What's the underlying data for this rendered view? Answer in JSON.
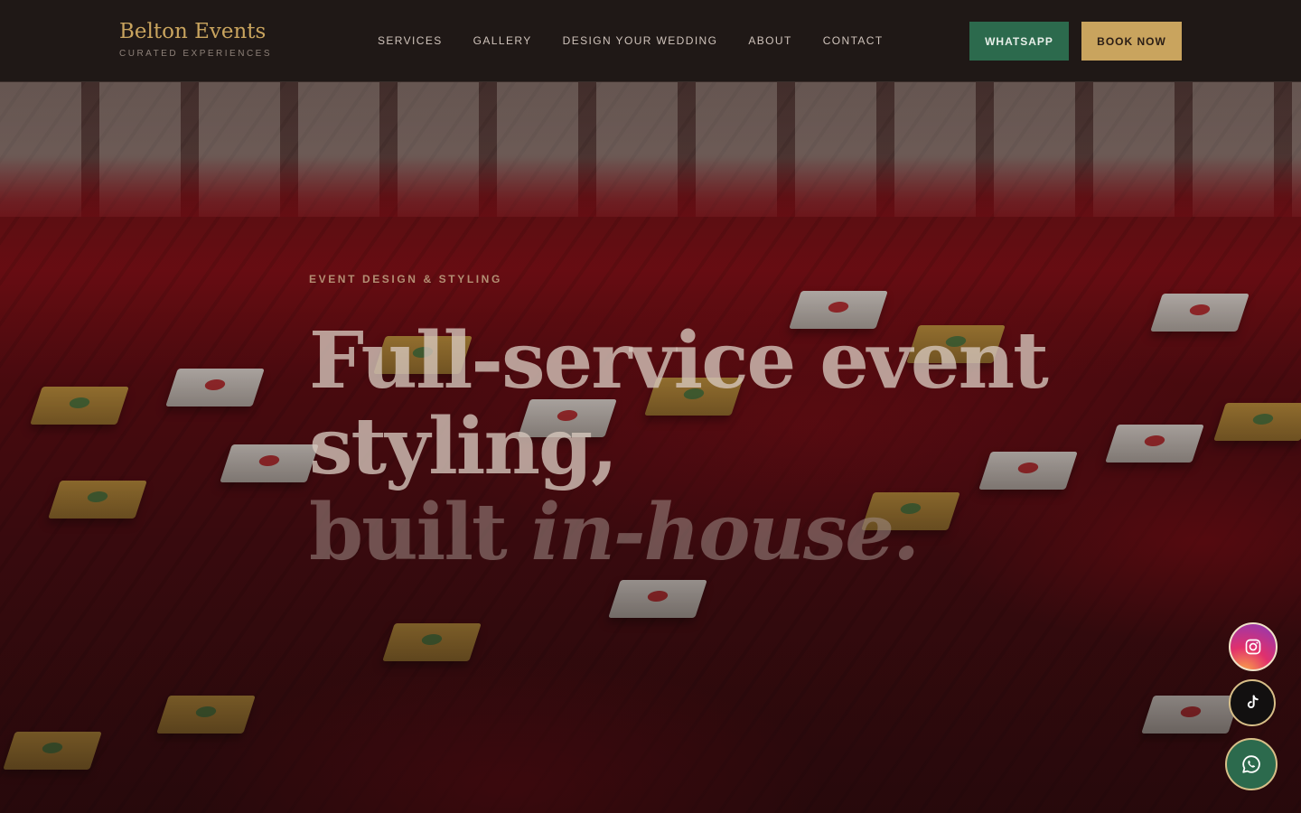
{
  "brand": {
    "name": "Belton Events",
    "tagline": "CURATED EXPERIENCES"
  },
  "nav": {
    "items": [
      {
        "label": "SERVICES"
      },
      {
        "label": "GALLERY"
      },
      {
        "label": "DESIGN YOUR WEDDING"
      },
      {
        "label": "ABOUT"
      },
      {
        "label": "CONTACT"
      }
    ]
  },
  "header_actions": {
    "whatsapp_label": "WHATSAPP",
    "book_label": "BOOK NOW"
  },
  "hero": {
    "eyebrow": "EVENT DESIGN & STYLING",
    "headline_line1": "Full-service event",
    "headline_line2": "styling,",
    "headline_line3_plain": "built ",
    "headline_line3_italic": "in-house."
  },
  "social": {
    "instagram_icon": "instagram-icon",
    "tiktok_icon": "tiktok-icon",
    "whatsapp_icon": "whatsapp-icon"
  },
  "colors": {
    "gold": "#c9a45e",
    "green": "#2c6a4d",
    "header_bg": "#1f1816"
  }
}
